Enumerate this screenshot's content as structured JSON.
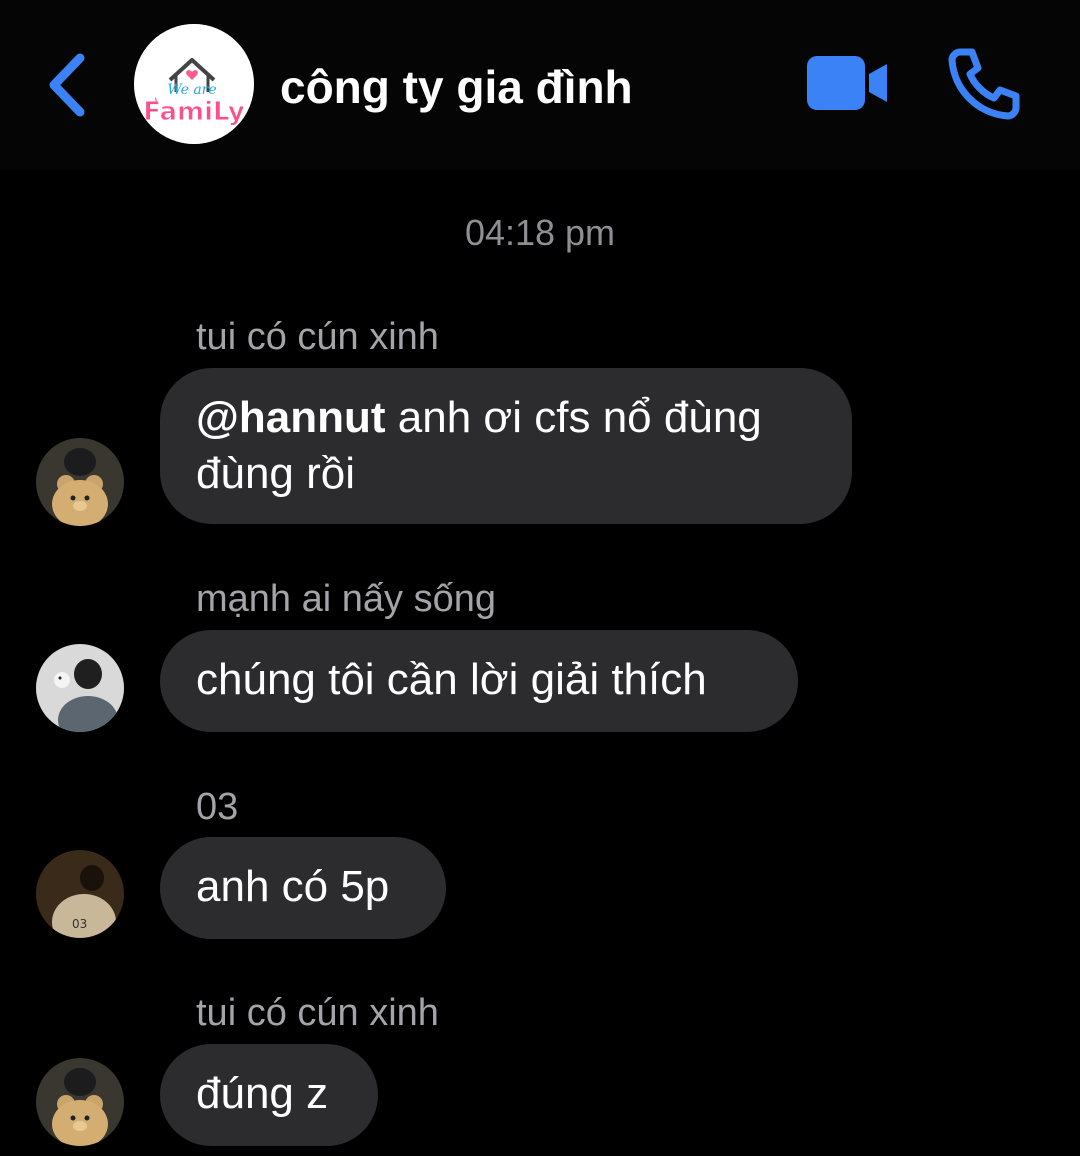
{
  "header": {
    "title": "công ty gia đình",
    "back_icon": "chevron-left-icon",
    "video_icon": "video-camera-icon",
    "call_icon": "phone-icon",
    "accent_color": "#3b82f6",
    "group_avatar_text_top": "We are",
    "group_avatar_text_bottom": "FamiLy"
  },
  "timestamp": "04:18 pm",
  "messages": [
    {
      "sender": "tui có cún xinh",
      "mention": "@hannut",
      "text": " anh ơi cfs nổ đùng đùng rồi"
    },
    {
      "sender": "mạnh ai nấy sống",
      "text": "chúng tôi cần lời giải thích"
    },
    {
      "sender": "03",
      "text": "anh có 5p"
    },
    {
      "sender": "tui có cún xinh",
      "text": "đúng z"
    }
  ],
  "colors": {
    "background": "#000000",
    "bubble": "#2c2c2e",
    "sender_text": "#a3a3a8",
    "timestamp_text": "#8e8e93"
  }
}
